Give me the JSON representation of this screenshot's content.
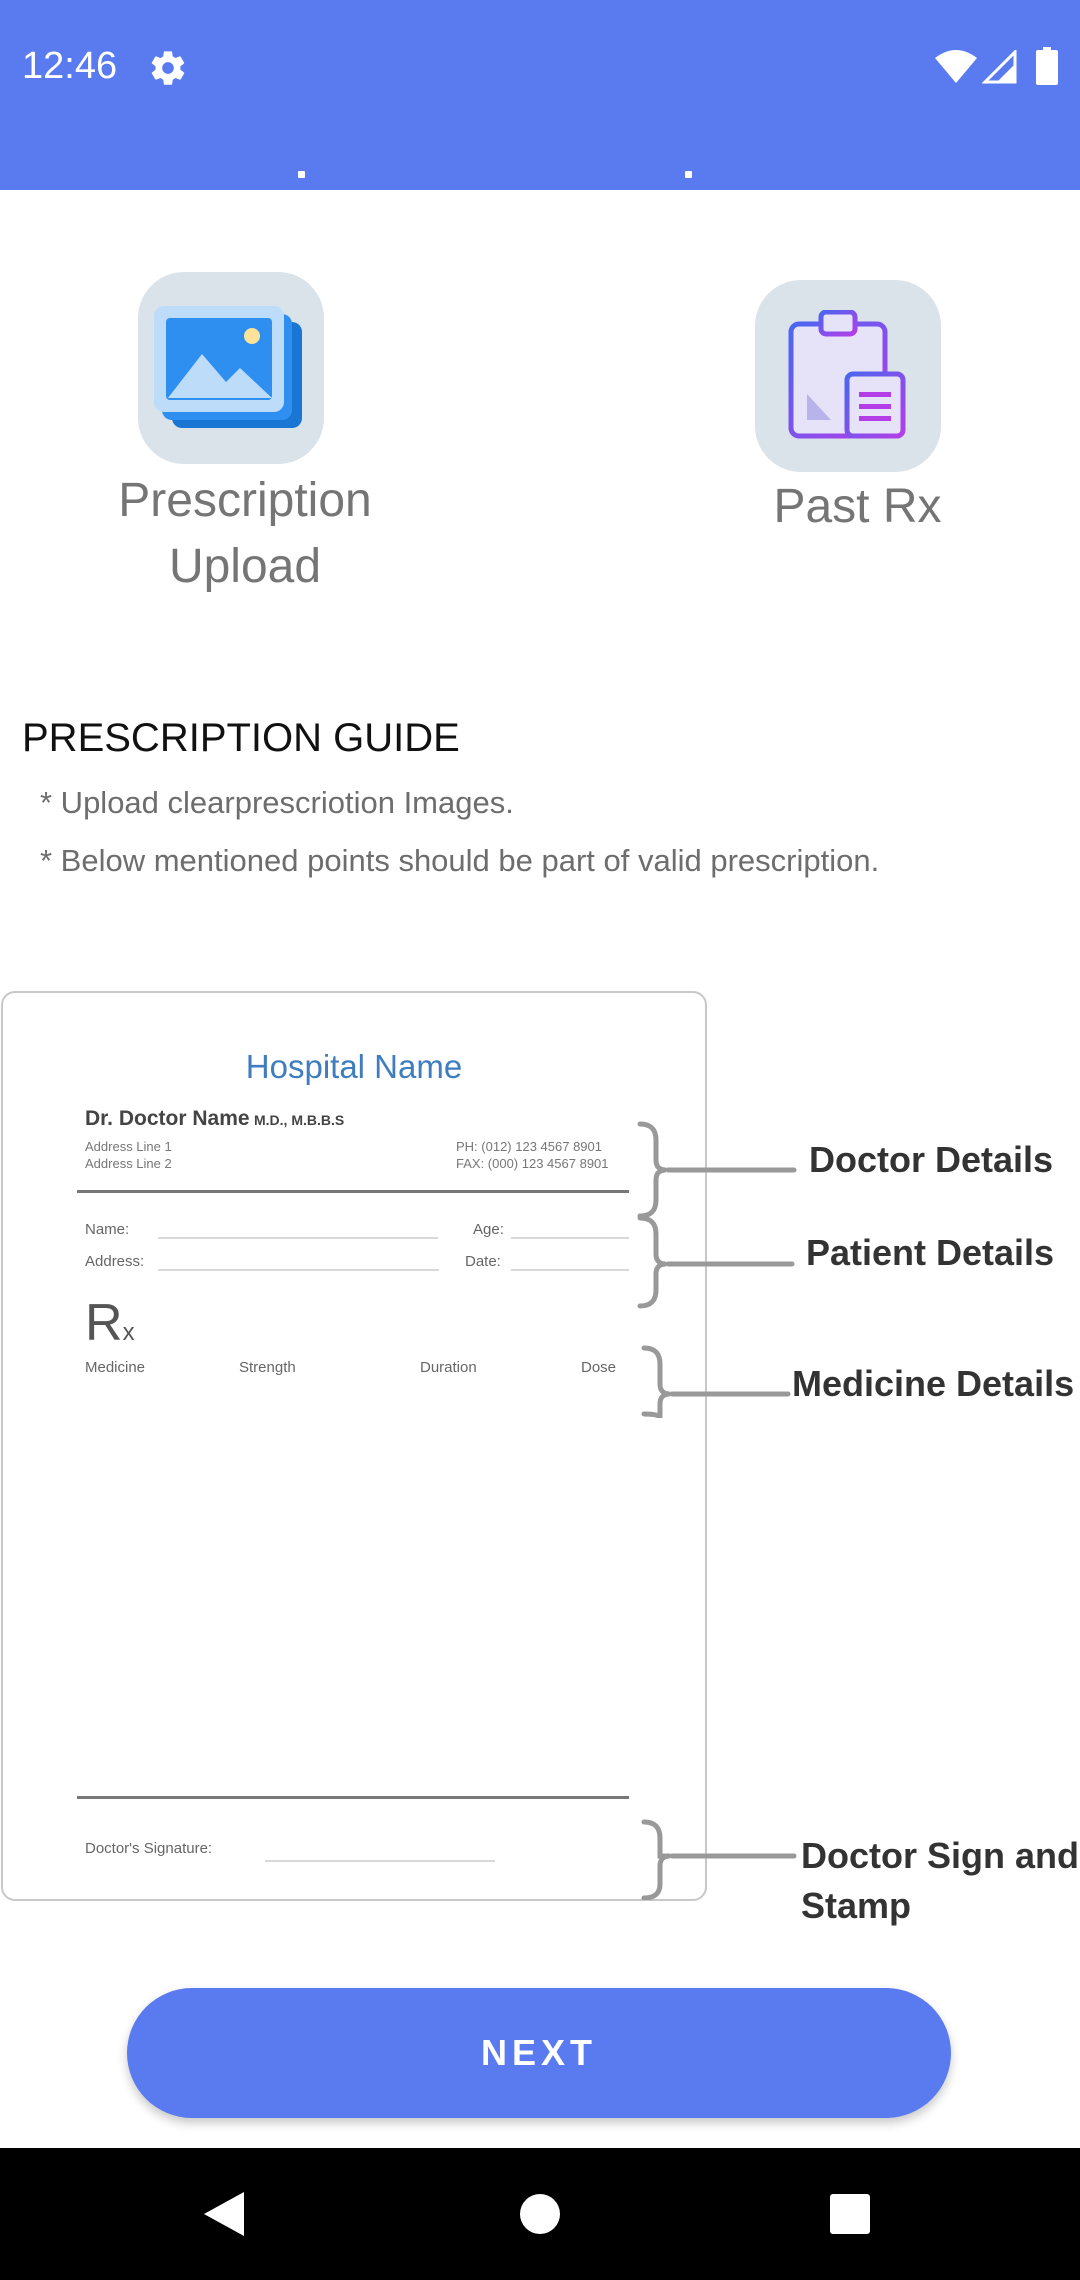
{
  "status_bar": {
    "time": "12:46",
    "color": "#5a7bef",
    "icons": [
      "gear-icon",
      "wifi-icon",
      "signal-icon",
      "battery-icon"
    ]
  },
  "options": {
    "upload_label_line1": "Prescription",
    "upload_label_line2": "Upload",
    "upload_icon": "image-gallery-icon",
    "past_label": "Past Rx",
    "past_icon": "clipboard-icon"
  },
  "guide": {
    "title": "PRESCRIPTION GUIDE",
    "items": [
      "* Upload clearprescriotion Images.",
      "* Below mentioned points should be part of valid prescription."
    ]
  },
  "sample": {
    "hospital_name": "Hospital Name",
    "doctor_name": "Dr. Doctor Name",
    "doctor_degrees": "M.D., M.B.B.S",
    "address_line1": "Address Line 1",
    "address_line2": "Address Line 2",
    "phone": "PH: (012) 123 4567 8901",
    "fax": "FAX: (000) 123 4567 8901",
    "name_label": "Name:",
    "age_label": "Age:",
    "address_label": "Address:",
    "date_label": "Date:",
    "rx_main": "R",
    "rx_sub": "x",
    "columns": [
      "Medicine",
      "Strength",
      "Duration",
      "Dose"
    ],
    "signature_label": "Doctor's Signature:",
    "annotations": [
      "Doctor Details",
      "Patient Details",
      "Medicine Details",
      "Doctor Sign and",
      "Stamp"
    ]
  },
  "next_button": {
    "label": "NEXT"
  },
  "nav_bar": {
    "icons": [
      "back-icon",
      "home-icon",
      "recents-icon"
    ]
  }
}
